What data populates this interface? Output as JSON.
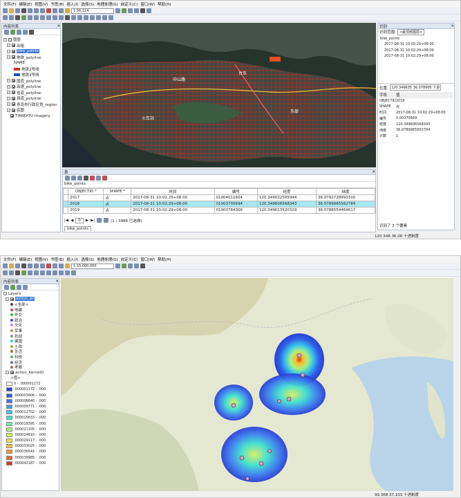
{
  "menu": [
    "文件(F)",
    "编辑(E)",
    "视图(V)",
    "书签(B)",
    "插入(I)",
    "选择(S)",
    "地理处理(G)",
    "自定义(C)",
    "窗口(W)",
    "帮助(H)"
  ],
  "window1": {
    "scale": "1:56,114",
    "toc": {
      "title": "内容列表",
      "layers": [
        {
          "label": "图层",
          "indent": 0,
          "checked": false
        },
        {
          "label": "出租",
          "indent": 1,
          "checked": true
        },
        {
          "label": "bike_points",
          "indent": 1,
          "checked": true,
          "selected": true
        },
        {
          "label": "地铁_polyline",
          "indent": 1,
          "checked": true
        },
        {
          "label": "NAME",
          "indent": 3,
          "checked": false
        },
        {
          "label": "地铁2号线",
          "indent": 3,
          "checked": false,
          "swatch": "#d03030"
        },
        {
          "label": "地铁3号线",
          "indent": 3,
          "checked": false,
          "swatch": "#2050c0"
        },
        {
          "label": "国道_polyline",
          "indent": 1,
          "checked": true
        },
        {
          "label": "高速_polyline",
          "indent": 1,
          "checked": true
        },
        {
          "label": "省道_polyline",
          "indent": 1,
          "checked": true
        },
        {
          "label": "县道_polyline",
          "indent": 1,
          "checked": true
        },
        {
          "label": "青岛市行政区划_region",
          "indent": 1,
          "checked": true
        },
        {
          "label": "底图",
          "indent": 1,
          "checked": true
        },
        {
          "label": "TIANDITU Imagery",
          "indent": 2,
          "checked": true
        }
      ]
    },
    "map_labels": [
      {
        "t": "中山路",
        "c": "#fff"
      },
      {
        "t": "火车站",
        "c": "#fff"
      },
      {
        "t": "东部",
        "c": "#fff"
      },
      {
        "t": "台东",
        "c": "#fff"
      }
    ],
    "identify": {
      "title": "识别",
      "from_label": "识别范围:",
      "from_value": "<最顶部图层>",
      "tree": [
        "bike_points",
        "2017-08-31 10:02:29+08:00",
        "2017-08-31 10:02:29+08:00",
        "2017-08-31 10:02:29+08:00"
      ],
      "location_label": "位置:",
      "location_value": "120.349635 36.078995 十进",
      "field_header": "字段",
      "value_header": "值",
      "fields": [
        {
          "f": "OBJECTID",
          "v": "2016"
        },
        {
          "f": "SHAPE",
          "v": "点"
        },
        {
          "f": "时间",
          "v": "2017-08-31 10:02:29+08:00"
        },
        {
          "f": "编号",
          "v": "0.00370569"
        },
        {
          "f": "经度",
          "v": "120.349606568343"
        },
        {
          "f": "纬度",
          "v": "36.0789965562784"
        },
        {
          "f": "计数",
          "v": "1"
        }
      ],
      "footer": "识别了 3 个要素"
    },
    "table": {
      "panel_title": "表",
      "layer_name": "bike_points",
      "headers": [
        "OBJECTID *",
        "SHAPE *",
        "时间",
        "编号",
        "经度",
        "纬度"
      ],
      "rows": [
        [
          "2017",
          "点",
          "2017-08-31 10:02:29+08:00",
          "01004011604",
          "120.349032505944",
          "36.0792728993316"
        ],
        [
          "2018",
          "点",
          "2017-08-31 10:02:29+08:00",
          "01003705694",
          "120.349606568343",
          "36.0789965562784"
        ],
        [
          "2019",
          "点",
          "2017-08-31 10:02:29+08:00",
          "01003784306",
          "120.349613520329",
          "36.0788554469617"
        ]
      ],
      "nav_page": "0",
      "selection": "(1 / 3986 已选择)",
      "tab": "bike_points"
    },
    "status": "120.348  36.08 十进制度"
  },
  "window2": {
    "scale": "1:15,000,000",
    "toc": {
      "title": "内容列表",
      "items": [
        {
          "label": "Layers",
          "type": "group"
        },
        {
          "label": "action_all",
          "type": "layer",
          "selected": true
        },
        {
          "label": "<全部>",
          "type": "cat",
          "color": "#444"
        },
        {
          "label": "电建",
          "type": "cat",
          "color": "#d44"
        },
        {
          "label": "外交",
          "type": "cat",
          "color": "#4a4"
        },
        {
          "label": "政治",
          "type": "cat",
          "color": "#44c"
        },
        {
          "label": "文化",
          "type": "cat",
          "color": "#c8c"
        },
        {
          "label": "军事",
          "type": "cat",
          "color": "#c84"
        },
        {
          "label": "抗战",
          "type": "cat",
          "color": "#888"
        },
        {
          "label": "建国",
          "type": "cat",
          "color": "#4cc"
        },
        {
          "label": "土改",
          "type": "cat",
          "color": "#aa4"
        },
        {
          "label": "生活",
          "type": "cat",
          "color": "#a64"
        },
        {
          "label": "科技",
          "type": "cat",
          "color": "#6a6"
        },
        {
          "label": "经济",
          "type": "cat",
          "color": "#66a"
        },
        {
          "label": "考察",
          "type": "cat",
          "color": "#a66"
        },
        {
          "label": "action_KernelD",
          "type": "layer"
        },
        {
          "label": "<值>",
          "type": "sub"
        }
      ],
      "ramp": [
        {
          "label": "0 - .000001172",
          "color": "#ffffff"
        },
        {
          "label": ".000001172 - .000",
          "color": "#2a3fd6"
        },
        {
          "label": ".000003906 - .000",
          "color": "#2f5ee8"
        },
        {
          "label": ".000006640 - .000",
          "color": "#3a7cf0"
        },
        {
          "label": ".000009771 - .000",
          "color": "#3aa0f0"
        },
        {
          "label": ".000012702 - .000",
          "color": "#3ac8e8"
        },
        {
          "label": ".000015633 - .000",
          "color": "#40e0d0"
        },
        {
          "label": ".000018395 - .000",
          "color": "#70ecb0"
        },
        {
          "label": ".000021105 - .000",
          "color": "#a8f080"
        },
        {
          "label": ".000024610 - .000",
          "color": "#d8f060"
        },
        {
          "label": ".000029117 - .000",
          "color": "#f0e040"
        },
        {
          "label": ".000033025 - .000",
          "color": "#f8c030"
        },
        {
          "label": ".000036541 - .000",
          "color": "#f89828"
        },
        {
          "label": ".000039985 - .000",
          "color": "#f06820"
        },
        {
          "label": ".000042187 - .000",
          "color": "#e03818"
        }
      ]
    },
    "status": "99.368  37.103 十进制度"
  }
}
